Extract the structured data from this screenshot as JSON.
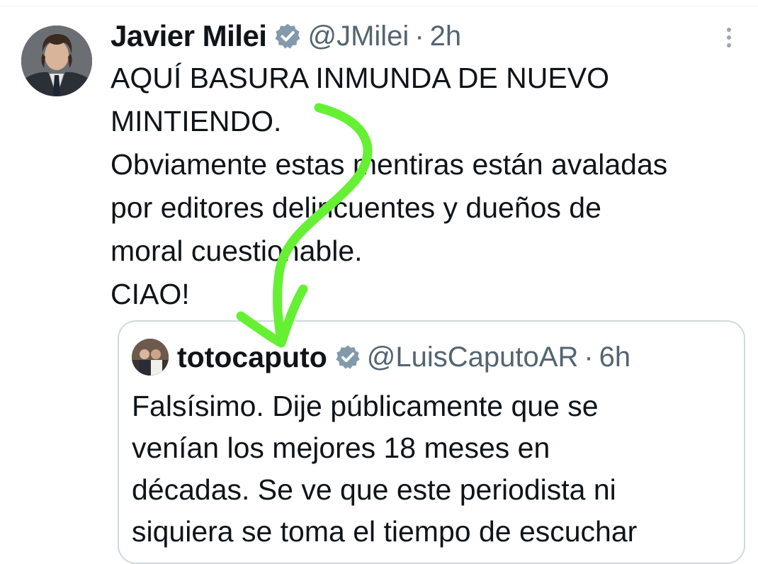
{
  "tweet": {
    "author_name": "Javier Milei",
    "handle": "@JMilei",
    "separator": "·",
    "time": "2h",
    "lines": [
      "AQUÍ BASURA INMUNDA DE NUEVO",
      "MINTIENDO.",
      "Obviamente estas mentiras están avaladas",
      "por editores delincuentes y dueños de",
      "moral cuestionable.",
      "CIAO!"
    ]
  },
  "quoted_tweet": {
    "author_name": "totocaputo",
    "handle": "@LuisCaputoAR",
    "separator": "·",
    "time": "6h",
    "lines": [
      "Falsísimo. Dije públicamente que se",
      "venían los mejores 18 meses en",
      "décadas. Se ve que este periodista ni",
      "siquiera se toma el tiempo de escuchar"
    ]
  },
  "icons": {
    "verified": "verified-badge-icon",
    "more": "more-options-icon"
  },
  "colors": {
    "verified_badge": "#829aab",
    "muted_text": "#536471",
    "annotation_arrow": "#66f033",
    "border": "#cfd9de"
  }
}
